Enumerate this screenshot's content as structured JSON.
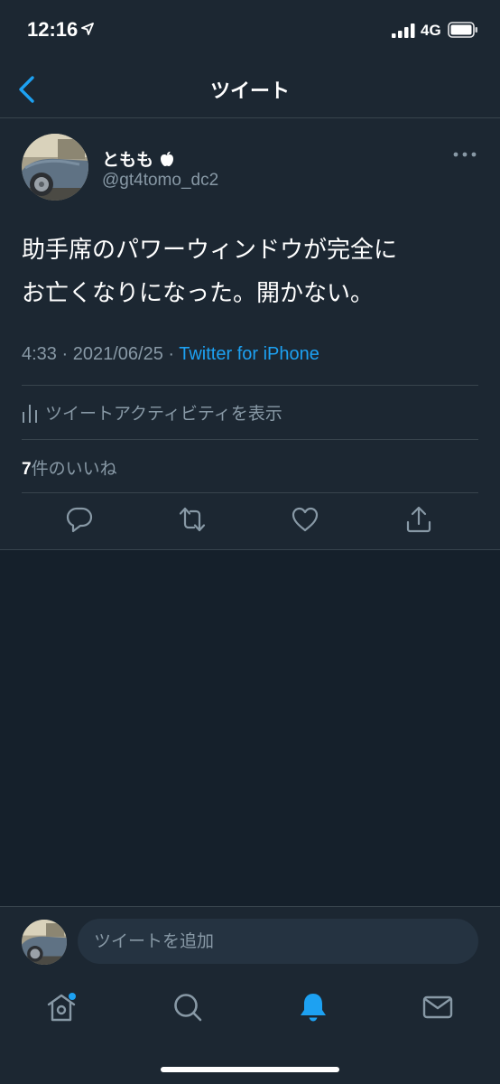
{
  "status_bar": {
    "time": "12:16",
    "network": "4G"
  },
  "nav": {
    "title": "ツイート"
  },
  "tweet": {
    "display_name": "ともも",
    "handle": "@gt4tomo_dc2",
    "text_line1": "助手席のパワーウィンドウが完全に",
    "text_line2": "お亡くなりになった。開かない。",
    "time": "4:33",
    "date": "2021/06/25",
    "source": "Twitter for iPhone",
    "activity_label": "ツイートアクティビティを表示",
    "likes_count": "7",
    "likes_label": "件のいいね"
  },
  "reply": {
    "placeholder": "ツイートを追加"
  },
  "colors": {
    "background": "#15202b",
    "surface": "#1c2732",
    "accent": "#1da1f2",
    "secondary_text": "#8899a6",
    "divider": "#38444d",
    "notification_dot": "#1da1f2"
  },
  "icons": {
    "back": "chevron-left-icon",
    "more": "more-horizontal-icon",
    "activity": "bar-chart-icon",
    "reply": "comment-icon",
    "retweet": "retweet-icon",
    "like": "heart-icon",
    "share": "share-icon",
    "home": "home-icon",
    "search": "search-icon",
    "notifications": "bell-icon",
    "messages": "mail-icon"
  }
}
